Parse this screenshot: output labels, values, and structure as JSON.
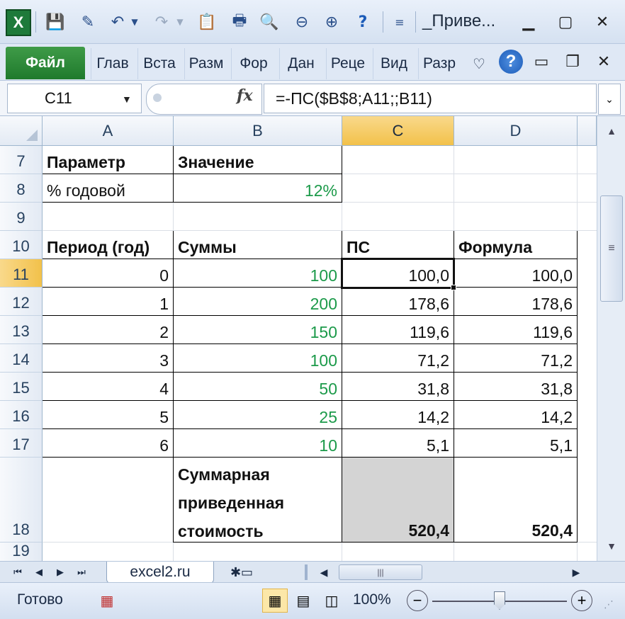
{
  "window": {
    "title": "_Приве...",
    "app_icon": "excel-icon",
    "minimize": "▭",
    "restore": "▢",
    "close": "✕"
  },
  "ribbon": {
    "file_tab": "Файл",
    "tabs": [
      "Глав",
      "Вста",
      "Разм",
      "Фор",
      "Дан",
      "Реце",
      "Вид",
      "Разр"
    ],
    "help": "?"
  },
  "formula_bar": {
    "name_box": "C11",
    "fx": "fx",
    "formula": "=-ПС($B$8;A11;;B11)"
  },
  "grid": {
    "columns": [
      "A",
      "B",
      "C",
      "D"
    ],
    "selected_column": "C",
    "row_numbers": [
      "7",
      "8",
      "9",
      "10",
      "11",
      "12",
      "13",
      "14",
      "15",
      "16",
      "17",
      "18",
      "19"
    ],
    "selected_row": "11",
    "param_header": "Параметр",
    "value_header": "Значение",
    "rate_label": "% годовой",
    "rate_value": "12%",
    "table_headers": [
      "Период (год)",
      "Суммы",
      "ПС",
      "Формула"
    ],
    "rows": [
      {
        "period": "0",
        "sum": "100",
        "pv": "100,0",
        "formula": "100,0"
      },
      {
        "period": "1",
        "sum": "200",
        "pv": "178,6",
        "formula": "178,6"
      },
      {
        "period": "2",
        "sum": "150",
        "pv": "119,6",
        "formula": "119,6"
      },
      {
        "period": "3",
        "sum": "100",
        "pv": "71,2",
        "formula": "71,2"
      },
      {
        "period": "4",
        "sum": "50",
        "pv": "31,8",
        "formula": "31,8"
      },
      {
        "period": "5",
        "sum": "25",
        "pv": "14,2",
        "formula": "14,2"
      },
      {
        "period": "6",
        "sum": "10",
        "pv": "5,1",
        "formula": "5,1"
      }
    ],
    "total_label_lines": [
      "Суммарная",
      "приведенная",
      "стоимость"
    ],
    "total_pv": "520,4",
    "total_formula": "520,4",
    "colors": {
      "green_value": "#1c9a4a",
      "selected_header": "#f2c14a",
      "total_fill": "#d4d4d4"
    }
  },
  "sheets": {
    "active": "excel2.ru",
    "nav": [
      "⏮",
      "◀",
      "▶",
      "⏭"
    ]
  },
  "status": {
    "ready": "Готово",
    "zoom": "100%",
    "zoom_level_percent": 100
  }
}
